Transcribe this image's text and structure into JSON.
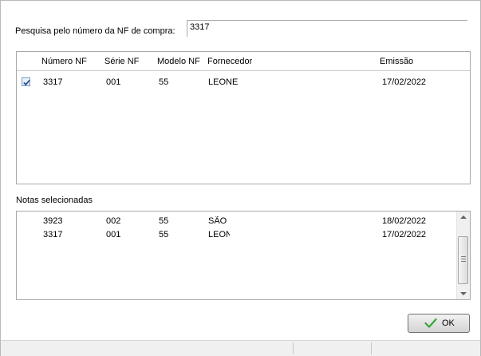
{
  "search": {
    "label": "Pesquisa pelo número da NF de compra:",
    "value": "3317"
  },
  "columns": [
    "Número NF",
    "Série NF",
    "Modelo NF",
    "Fornecedor",
    "Emissão"
  ],
  "results": [
    {
      "checked": true,
      "numero": "3317",
      "serie": "001",
      "modelo": "55",
      "fornecedor": "LEONE",
      "emissao": "17/02/2022"
    }
  ],
  "selected_section": {
    "label": "Notas selecionadas",
    "rows": [
      {
        "numero": "3923",
        "serie": "002",
        "modelo": "55",
        "fornecedor": "SÃO",
        "emissao": "18/02/2022"
      },
      {
        "numero": "3317",
        "serie": "001",
        "modelo": "55",
        "fornecedor": "LEON",
        "emissao": "17/02/2022"
      }
    ]
  },
  "ok_button": {
    "label": "OK",
    "icon": "check-icon"
  },
  "colors": {
    "check": "#3aa63a",
    "checkbox_border": "#7f9db9"
  }
}
